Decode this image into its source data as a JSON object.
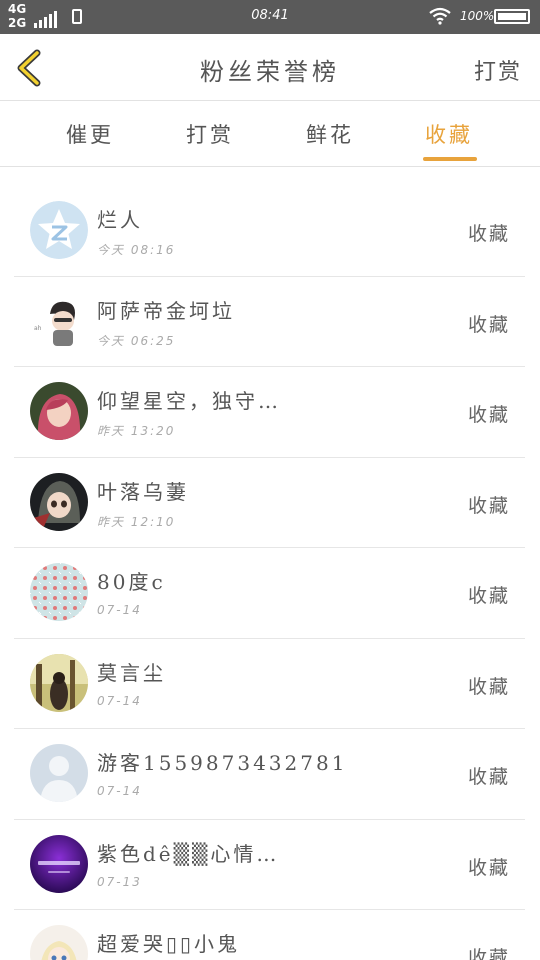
{
  "status_bar": {
    "network_top": "4G",
    "network_bottom": "2G",
    "time": "08:41",
    "battery": "100%"
  },
  "header": {
    "title": "粉丝荣誉榜",
    "right_action": "打赏"
  },
  "tabs": [
    {
      "label": "催更",
      "active": false
    },
    {
      "label": "打赏",
      "active": false
    },
    {
      "label": "鲜花",
      "active": false
    },
    {
      "label": "收藏",
      "active": true
    }
  ],
  "colors": {
    "accent": "#e8a33c",
    "statusbar": "#5a5a5a"
  },
  "fans": [
    {
      "name": "烂人",
      "time": "今天 08:16",
      "action": "收藏",
      "avatar": "qzone-star-icon"
    },
    {
      "name": "阿萨帝金坷垃",
      "time": "今天 06:25",
      "action": "收藏",
      "avatar": "cartoon-boy-avatar"
    },
    {
      "name": "仰望星空，独守…",
      "time": "昨天 13:20",
      "action": "收藏",
      "avatar": "pink-hair-girl-avatar"
    },
    {
      "name": "叶落乌萋",
      "time": "昨天 12:10",
      "action": "收藏",
      "avatar": "anime-hood-avatar"
    },
    {
      "name": "80度c",
      "time": "07-14",
      "action": "收藏",
      "avatar": "floral-pattern-avatar"
    },
    {
      "name": "莫言尘",
      "time": "07-14",
      "action": "收藏",
      "avatar": "forest-photo-avatar"
    },
    {
      "name": "游客1559873432781",
      "time": "07-14",
      "action": "收藏",
      "avatar": "default-person-avatar"
    },
    {
      "name": "紫色dê▒▒心情…",
      "time": "07-13",
      "action": "收藏",
      "avatar": "purple-text-avatar"
    },
    {
      "name": "超爱哭▯▯小鬼",
      "time": "",
      "action": "收藏",
      "avatar": "anime-girl-avatar"
    }
  ]
}
